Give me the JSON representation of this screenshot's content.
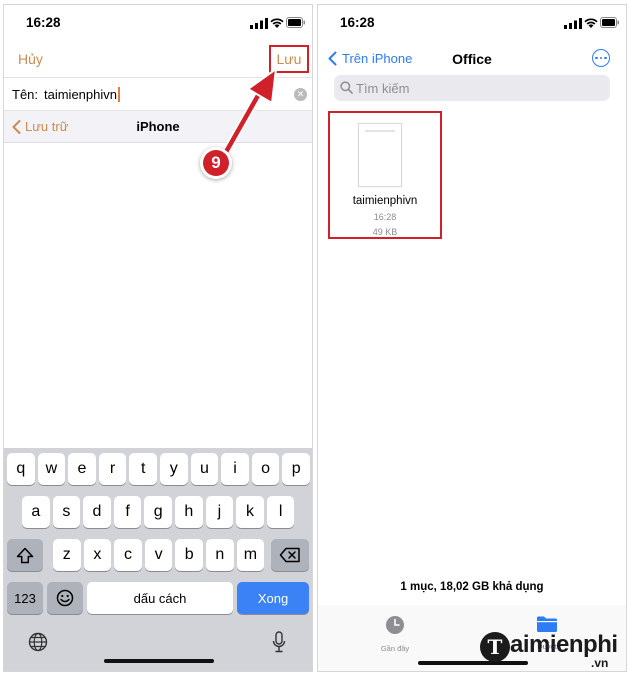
{
  "colors": {
    "accent_orange": "#c98c52",
    "accent_blue": "#2d7cf6",
    "highlight_red": "#d0202a"
  },
  "left_screen": {
    "status": {
      "time": "16:28"
    },
    "nav": {
      "cancel_label": "Hủy",
      "save_label": "Lưu"
    },
    "name_row": {
      "label": "Tên:",
      "value": "taimienphivn"
    },
    "location_row": {
      "back_label": "Lưu trữ",
      "title": "iPhone"
    },
    "step_badge": "9",
    "keyboard": {
      "row1": [
        "q",
        "w",
        "e",
        "r",
        "t",
        "y",
        "u",
        "i",
        "o",
        "p"
      ],
      "row2": [
        "a",
        "s",
        "d",
        "f",
        "g",
        "h",
        "j",
        "k",
        "l"
      ],
      "row3": [
        "z",
        "x",
        "c",
        "v",
        "b",
        "n",
        "m"
      ],
      "numbers_label": "123",
      "space_label": "dấu cách",
      "return_label": "Xong"
    }
  },
  "right_screen": {
    "status": {
      "time": "16:28"
    },
    "nav": {
      "back_label": "Trên iPhone",
      "title": "Office"
    },
    "search": {
      "placeholder": "Tìm kiếm"
    },
    "file": {
      "name": "taimienphivn",
      "time": "16:28",
      "size": "49 KB"
    },
    "storage_text": "1 mục, 18,02 GB khả dụng",
    "tabs": [
      {
        "label": "Gần đây",
        "icon": "clock-icon"
      },
      {
        "label": "Duyệt",
        "icon": "folder-icon"
      }
    ]
  },
  "watermark": {
    "mark": "T",
    "text": "aimienphi",
    "sub": ".vn"
  }
}
